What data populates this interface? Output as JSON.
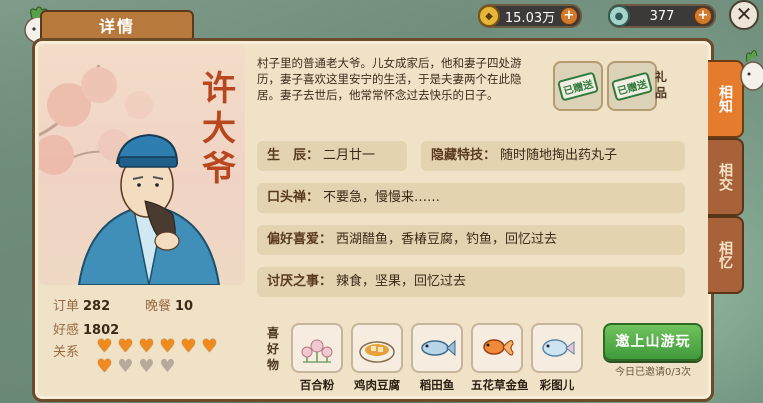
{
  "header": {
    "title": "详情"
  },
  "currency": {
    "gold": "15.03万",
    "jade": "377"
  },
  "character": {
    "name": "许大爷",
    "description": "村子里的普通老大爷。儿女成家后，他和妻子四处游历，妻子喜欢这里安宁的生活，于是夫妻两个在此隐居。妻子去世后，他常常怀念过去快乐的日子。",
    "stats": {
      "orders_label": "订单",
      "orders": "282",
      "dinner_label": "晚餐",
      "dinner": "10",
      "affection_label": "好感",
      "affection": "1802",
      "relation_label": "关系"
    },
    "relation_hearts": {
      "filled": 7,
      "total": 10
    }
  },
  "gifts": {
    "label": "礼品",
    "slots": [
      {
        "stamp": "已赠送"
      },
      {
        "stamp": "已赠送"
      }
    ]
  },
  "info": {
    "birthday_label": "生　辰：",
    "birthday": "二月廿一",
    "skill_label": "隐藏特技：",
    "skill": "随时随地掏出药丸子",
    "catchphrase_label": "口头禅：",
    "catchphrase": "不要急，慢慢来……",
    "hobby_label": "偏好喜爱：",
    "hobby": "西湖醋鱼，香椿豆腐，钓鱼，回忆过去",
    "dislike_label": "讨厌之事：",
    "dislike": "辣食，坚果，回忆过去"
  },
  "liked_items": {
    "label": "喜好物",
    "items": [
      {
        "name": "百合粉",
        "icon": "lily-flower-icon"
      },
      {
        "name": "鸡肉豆腐",
        "icon": "chicken-tofu-dish-icon"
      },
      {
        "name": "稻田鱼",
        "icon": "paddy-fish-icon"
      },
      {
        "name": "五花草金鱼",
        "icon": "goldfish-icon"
      },
      {
        "name": "彩图儿",
        "icon": "colorful-fish-icon"
      }
    ]
  },
  "invite": {
    "label": "邀上山游玩",
    "note": "今日已邀请0/3次"
  },
  "side_tabs": [
    {
      "label": "相知",
      "active": true
    },
    {
      "label": "相交",
      "active": false
    },
    {
      "label": "相忆",
      "active": false
    }
  ],
  "colors": {
    "accent": "#e57b2c",
    "name_red": "#b6471f",
    "panel": "#efe2c6",
    "button_green": "#4fae44"
  }
}
